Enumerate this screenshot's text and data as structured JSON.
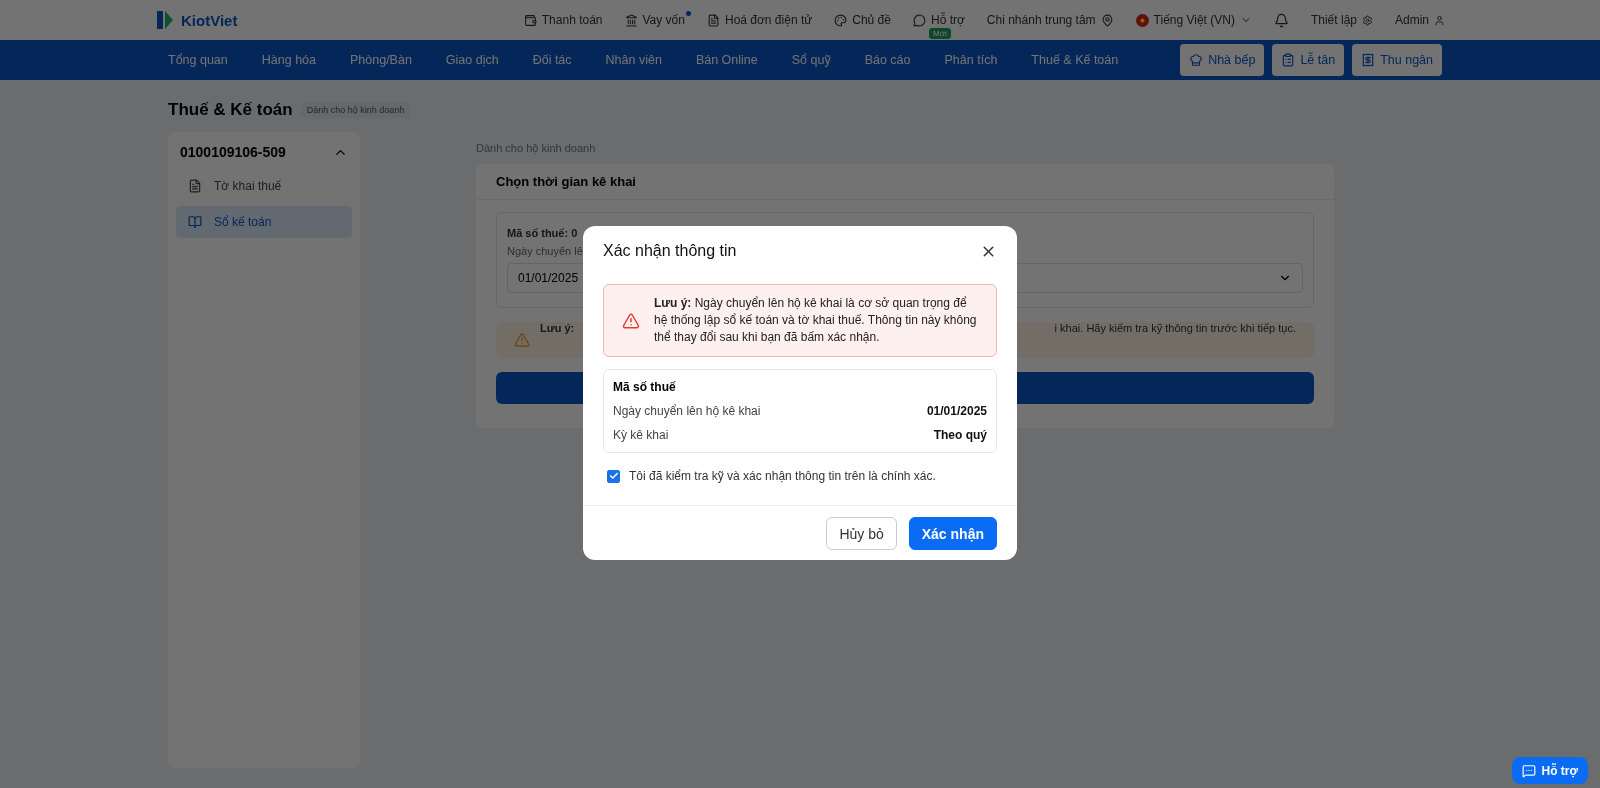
{
  "topbar": {
    "logo": "KiotViet",
    "links": [
      {
        "kind": "payment",
        "label": "Thanh toán"
      },
      {
        "kind": "loan",
        "label": "Vay vốn",
        "dot": true
      },
      {
        "kind": "invoice",
        "label": "Hoá đơn điện tử"
      },
      {
        "kind": "theme",
        "label": "Chủ đề"
      },
      {
        "kind": "support",
        "label": "Hỗ trợ",
        "badge": "Mới"
      }
    ],
    "branch": "Chi nhánh trung tâm",
    "language": "Tiếng Việt (VN)",
    "settings": "Thiết lập",
    "user": "Admin"
  },
  "nav": {
    "items": [
      {
        "label": "Tổng quan"
      },
      {
        "label": "Hàng hóa"
      },
      {
        "label": "Phòng/Bàn"
      },
      {
        "label": "Giao dịch"
      },
      {
        "label": "Đối tác"
      },
      {
        "label": "Nhân viên"
      },
      {
        "label": "Bán Online"
      },
      {
        "label": "Sổ quỹ"
      },
      {
        "label": "Báo cáo"
      },
      {
        "label": "Phân tích"
      },
      {
        "label": "Thuế & Kế toán"
      }
    ],
    "buttons": [
      {
        "kind": "kitchen",
        "label": "Nhà bếp"
      },
      {
        "kind": "reception",
        "label": "Lễ tân"
      },
      {
        "kind": "cashier",
        "label": "Thu ngân"
      }
    ]
  },
  "page": {
    "title": "Thuế & Kế toán",
    "tag": "Dành cho hộ kinh doanh"
  },
  "sidebar": {
    "group": "0100109106-509",
    "expanded": true,
    "items": [
      {
        "kind": "doc",
        "label": "Tờ khai thuế",
        "selected": false
      },
      {
        "kind": "book",
        "label": "Sổ kế toán",
        "selected": true
      }
    ]
  },
  "main": {
    "caption": "Dành cho hộ kinh doanh",
    "card_title": "Chọn thời gian kê khai",
    "tax_label": "Mã số thuế: 0",
    "date_label": "Ngày chuyển lê",
    "date_value": "01/01/2025",
    "warning_left": "Lưu ý:",
    "warning_right": "i khai. Hãy kiểm tra kỹ thông tin trước khi tiếp tục."
  },
  "dialog": {
    "title": "Xác nhận thông tin",
    "alert": "**Lưu ý:** Ngày chuyển lên hộ kê khai là cơ sở quan trọng để hệ thống lập sổ kế toán và tờ khai thuế. Thông tin này không thể thay đổi sau khi bạn đã bấm xác nhận.",
    "summary_title": "Mã số thuế",
    "rows": [
      {
        "label": "Ngày chuyển lên hộ kê khai",
        "value": "01/01/2025"
      },
      {
        "label": "Kỳ kê khai",
        "value": "Theo quý"
      }
    ],
    "confirm": {
      "label": "Tôi đã kiểm tra kỹ và xác nhận thông tin trên là chính xác.",
      "checked": true
    },
    "buttons": [
      {
        "kind": "secondary",
        "label": "Hủy bỏ"
      },
      {
        "kind": "primary",
        "label": "Xác nhận"
      }
    ]
  },
  "help_button": "Hỗ trợ"
}
